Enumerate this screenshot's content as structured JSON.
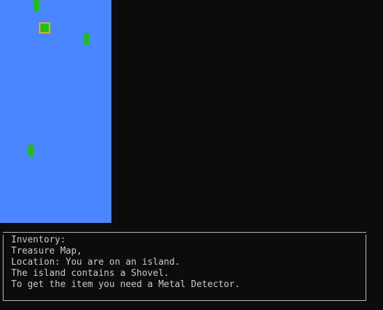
{
  "map": {
    "water_color": "#4a86ff",
    "island_color": "#1fbf12",
    "player_marker_color": "#e0b020",
    "islands": [
      {
        "id": "island-1",
        "current": false
      },
      {
        "id": "island-2",
        "current": true
      },
      {
        "id": "island-3",
        "current": false
      },
      {
        "id": "island-4",
        "current": false
      }
    ]
  },
  "console": {
    "inventory_label": "Inventory:",
    "inventory_items": "Treasure Map,",
    "location": "Location: You are on an island.",
    "contents": "The island contains a Shovel.",
    "requirement": "To get the item you need a Metal Detector."
  }
}
